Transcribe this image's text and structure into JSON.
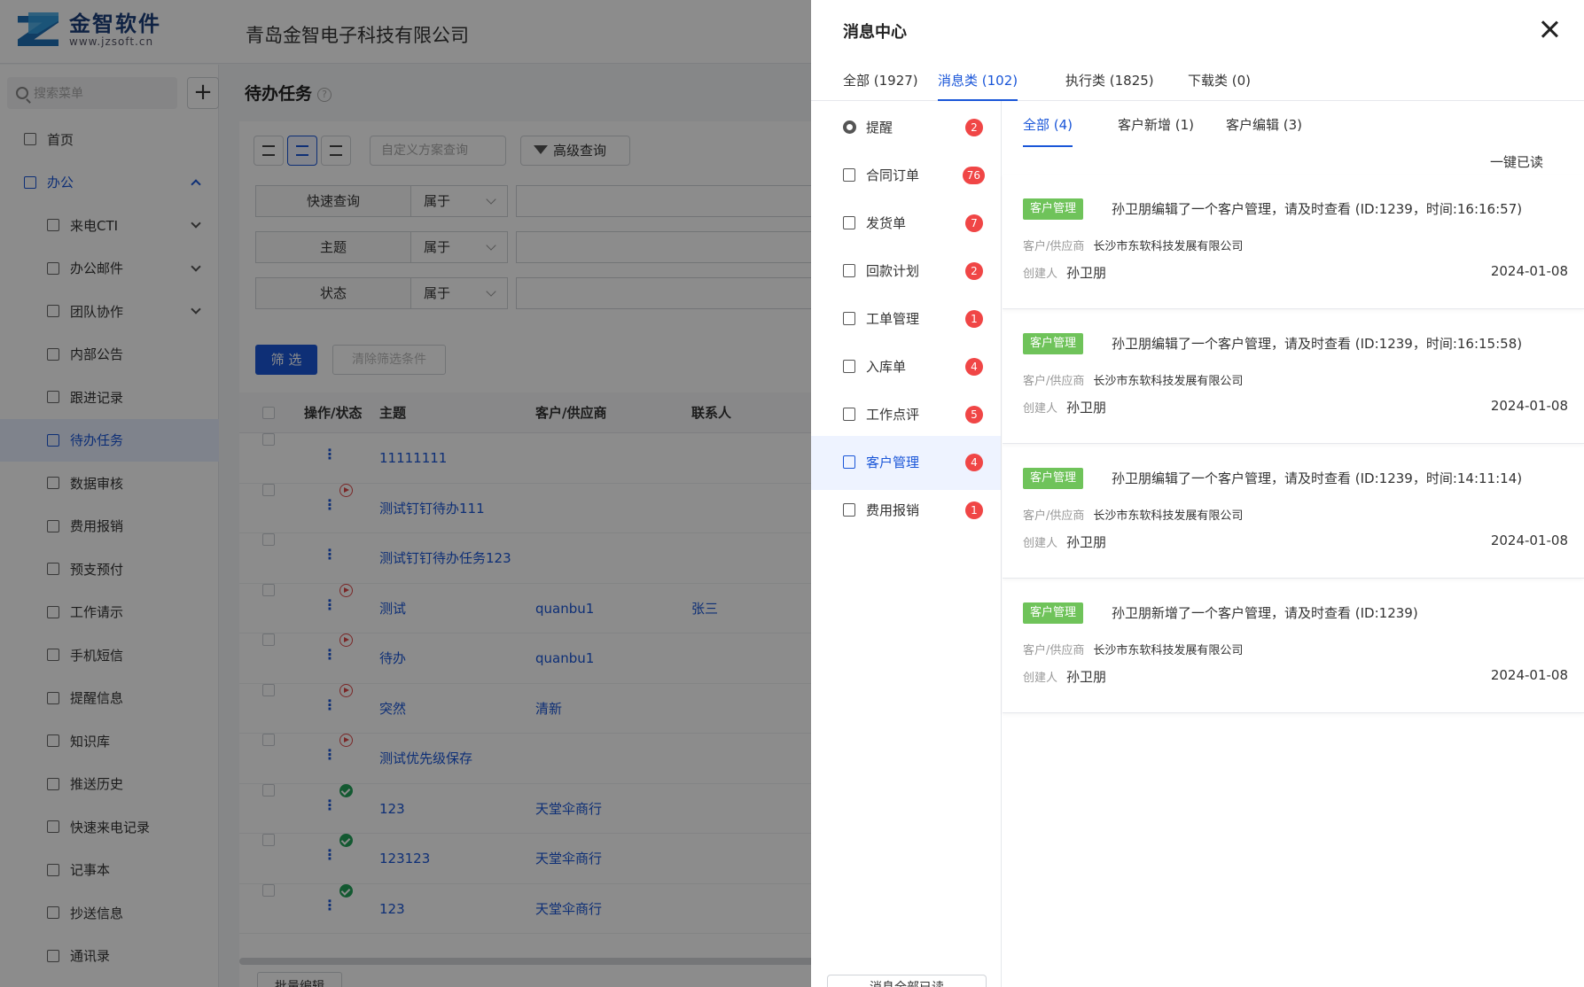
{
  "app": {
    "logo_text": "金智软件",
    "logo_url": "www.jzsoft.cn",
    "company": "青岛金智电子科技有限公司"
  },
  "sidebar": {
    "search_placeholder": "搜索菜单",
    "add_label": "+",
    "items": [
      {
        "label": "首页",
        "level": "top"
      },
      {
        "label": "办公",
        "level": "top",
        "expanded": true
      },
      {
        "label": "来电CTI",
        "level": "sub",
        "chevron": true
      },
      {
        "label": "办公邮件",
        "level": "sub",
        "chevron": true
      },
      {
        "label": "团队协作",
        "level": "sub",
        "chevron": true
      },
      {
        "label": "内部公告",
        "level": "sub"
      },
      {
        "label": "跟进记录",
        "level": "sub"
      },
      {
        "label": "待办任务",
        "level": "sub",
        "active": true
      },
      {
        "label": "数据审核",
        "level": "sub"
      },
      {
        "label": "费用报销",
        "level": "sub"
      },
      {
        "label": "预支预付",
        "level": "sub"
      },
      {
        "label": "工作请示",
        "level": "sub"
      },
      {
        "label": "手机短信",
        "level": "sub"
      },
      {
        "label": "提醒信息",
        "level": "sub"
      },
      {
        "label": "知识库",
        "level": "sub"
      },
      {
        "label": "推送历史",
        "level": "sub"
      },
      {
        "label": "快速来电记录",
        "level": "sub"
      },
      {
        "label": "记事本",
        "level": "sub"
      },
      {
        "label": "抄送信息",
        "level": "sub"
      },
      {
        "label": "通讯录",
        "level": "sub"
      }
    ]
  },
  "main": {
    "title": "待办任务",
    "help": "?",
    "scheme_placeholder": "自定义方案查询",
    "advanced_query": "高级查询",
    "filters": [
      {
        "field": "快速查询",
        "op": "属于"
      },
      {
        "field": "主题",
        "op": "属于"
      },
      {
        "field": "状态",
        "op": "属于"
      }
    ],
    "filter_button": "筛 选",
    "clear_button": "清除筛选条件",
    "columns": [
      "操作/状态",
      "主题",
      "客户/供应商",
      "联系人"
    ],
    "rows": [
      {
        "subject": "11111111",
        "customer": "",
        "contact": "",
        "status": ""
      },
      {
        "subject": "测试钉钉待办111",
        "customer": "",
        "contact": "",
        "status": "red"
      },
      {
        "subject": "测试钉钉待办任务123",
        "customer": "",
        "contact": "",
        "status": ""
      },
      {
        "subject": "测试",
        "customer": "quanbu1",
        "contact": "张三",
        "status": "red"
      },
      {
        "subject": "待办",
        "customer": "quanbu1",
        "contact": "",
        "status": "red"
      },
      {
        "subject": "突然",
        "customer": "清新",
        "contact": "",
        "status": "red"
      },
      {
        "subject": "测试优先级保存",
        "customer": "",
        "contact": "",
        "status": "red"
      },
      {
        "subject": "123",
        "customer": "天堂伞商行",
        "contact": "",
        "status": "green"
      },
      {
        "subject": "123123",
        "customer": "天堂伞商行",
        "contact": "",
        "status": "green"
      },
      {
        "subject": "123",
        "customer": "天堂伞商行",
        "contact": "",
        "status": "green"
      }
    ],
    "batch_edit": "批量编辑"
  },
  "drawer": {
    "title": "消息中心",
    "tabs": [
      {
        "label": "全部 (1927)"
      },
      {
        "label": "消息类 (102)",
        "active": true
      },
      {
        "label": "执行类 (1825)"
      },
      {
        "label": "下载类 (0)"
      }
    ],
    "categories": [
      {
        "label": "提醒",
        "count": "2"
      },
      {
        "label": "合同订单",
        "count": "76"
      },
      {
        "label": "发货单",
        "count": "7"
      },
      {
        "label": "回款计划",
        "count": "2"
      },
      {
        "label": "工单管理",
        "count": "1"
      },
      {
        "label": "入库单",
        "count": "4"
      },
      {
        "label": "工作点评",
        "count": "5"
      },
      {
        "label": "客户管理",
        "count": "4",
        "active": true
      },
      {
        "label": "费用报销",
        "count": "1"
      }
    ],
    "read_all_button": "消息全部已读",
    "subtabs": [
      {
        "label": "全部 (4)",
        "active": true
      },
      {
        "label": "客户新增 (1)"
      },
      {
        "label": "客户编辑 (3)"
      }
    ],
    "mark_all_read": "一键已读",
    "messages": [
      {
        "tag": "客户管理",
        "text": "孙卫朋编辑了一个客户管理，请及时查看 (ID:1239，时间:16:16:57)",
        "customer_label": "客户/供应商",
        "customer": "长沙市东软科技发展有限公司",
        "creator_label": "创建人",
        "creator": "孙卫朋",
        "date": "2024-01-08"
      },
      {
        "tag": "客户管理",
        "text": "孙卫朋编辑了一个客户管理，请及时查看 (ID:1239，时间:16:15:58)",
        "customer_label": "客户/供应商",
        "customer": "长沙市东软科技发展有限公司",
        "creator_label": "创建人",
        "creator": "孙卫朋",
        "date": "2024-01-08"
      },
      {
        "tag": "客户管理",
        "text": "孙卫朋编辑了一个客户管理，请及时查看 (ID:1239，时间:14:11:14)",
        "customer_label": "客户/供应商",
        "customer": "长沙市东软科技发展有限公司",
        "creator_label": "创建人",
        "creator": "孙卫朋",
        "date": "2024-01-08"
      },
      {
        "tag": "客户管理",
        "text": "孙卫朋新增了一个客户管理，请及时查看 (ID:1239)",
        "customer_label": "客户/供应商",
        "customer": "长沙市东软科技发展有限公司",
        "creator_label": "创建人",
        "creator": "孙卫朋",
        "date": "2024-01-08"
      }
    ]
  },
  "colors": {
    "accent": "#1a56d8",
    "badge": "#f04646",
    "tag": "#6fc35a",
    "overlay": "rgba(0,0,0,0.45)"
  }
}
